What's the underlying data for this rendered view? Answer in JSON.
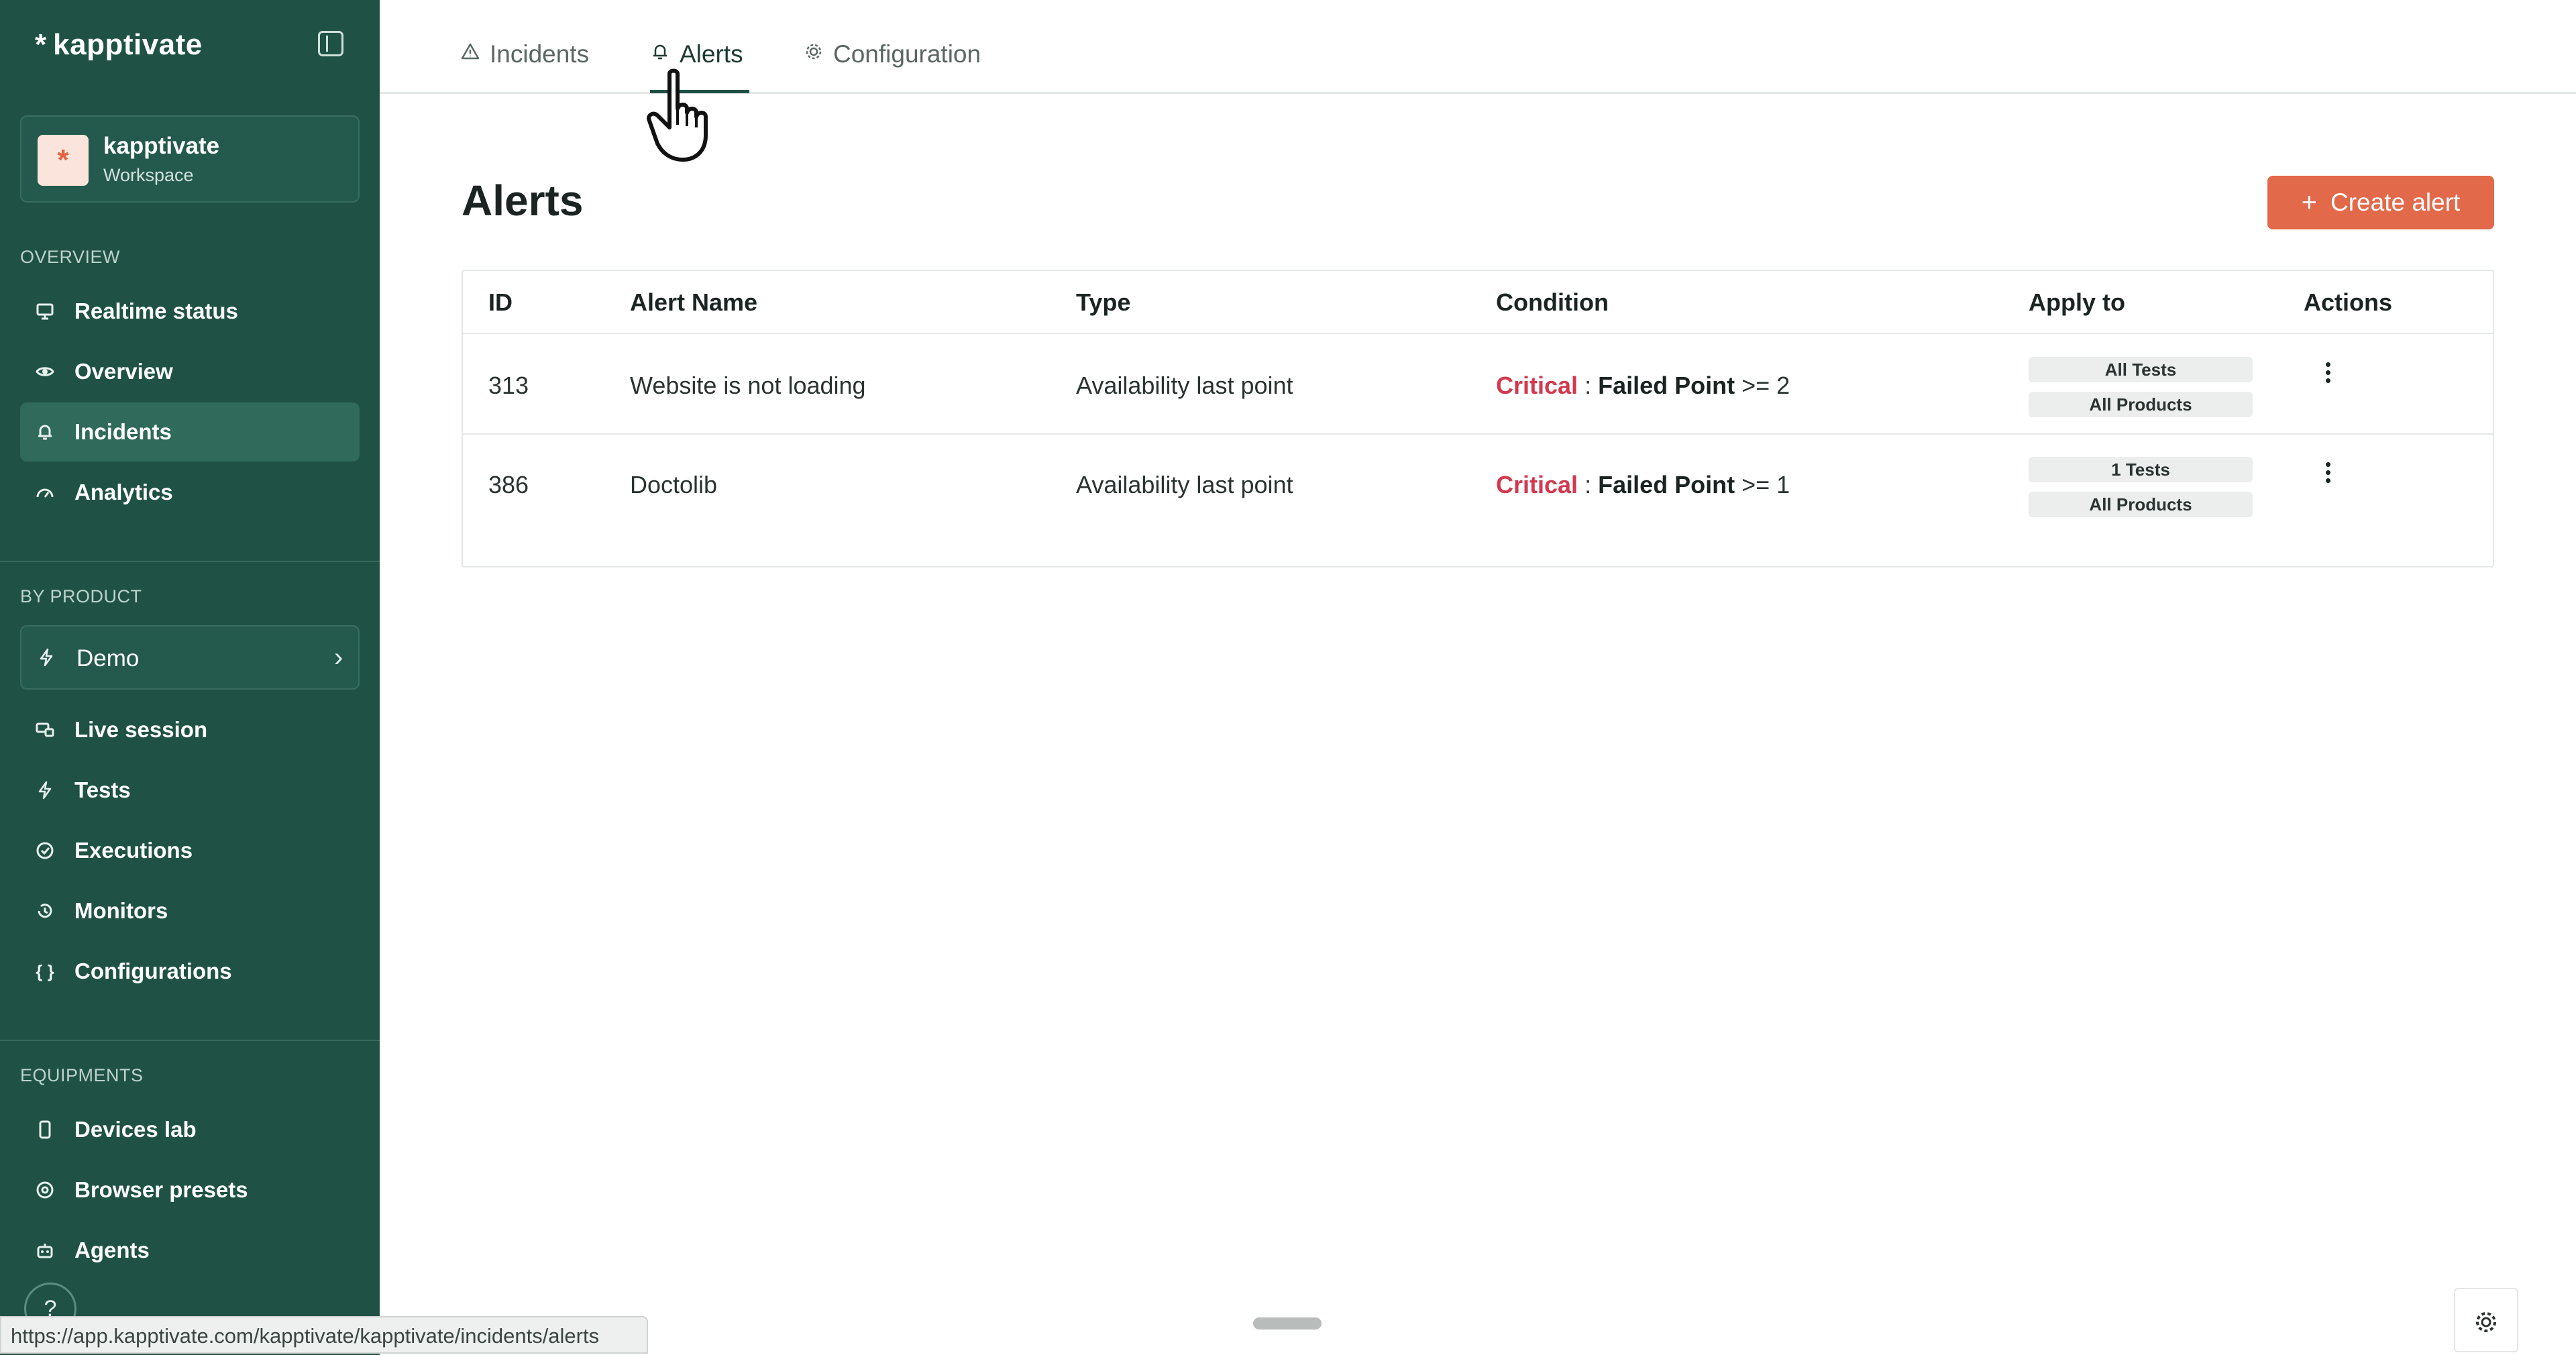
{
  "brand": {
    "name": "kapptivate",
    "mark": "*"
  },
  "workspace": {
    "name": "kapptivate",
    "subtitle": "Workspace",
    "avatar": "*"
  },
  "sidebar": {
    "overview_label": "OVERVIEW",
    "overview_items": [
      {
        "label": "Realtime status",
        "icon": "monitor-icon"
      },
      {
        "label": "Overview",
        "icon": "eye-icon"
      },
      {
        "label": "Incidents",
        "icon": "bell-icon",
        "active": true
      },
      {
        "label": "Analytics",
        "icon": "gauge-icon"
      }
    ],
    "by_product_label": "BY PRODUCT",
    "product": {
      "label": "Demo",
      "icon": "lightning-icon"
    },
    "product_items": [
      {
        "label": "Live session",
        "icon": "screens-icon"
      },
      {
        "label": "Tests",
        "icon": "lightning-icon"
      },
      {
        "label": "Executions",
        "icon": "check-circle-icon"
      },
      {
        "label": "Monitors",
        "icon": "history-icon"
      },
      {
        "label": "Configurations",
        "icon": "braces-icon"
      }
    ],
    "equipments_label": "EQUIPMENTS",
    "equipment_items": [
      {
        "label": "Devices lab",
        "icon": "phone-icon"
      },
      {
        "label": "Browser presets",
        "icon": "chrome-icon"
      },
      {
        "label": "Agents",
        "icon": "robot-icon"
      }
    ],
    "help": "?"
  },
  "tabs": [
    {
      "label": "Incidents",
      "icon": "warning-icon"
    },
    {
      "label": "Alerts",
      "icon": "bell-icon",
      "active": true
    },
    {
      "label": "Configuration",
      "icon": "gear-icon"
    }
  ],
  "page": {
    "title": "Alerts",
    "create_label": "Create alert",
    "create_plus": "+"
  },
  "table": {
    "headers": [
      "ID",
      "Alert Name",
      "Type",
      "Condition",
      "Apply to",
      "Actions"
    ],
    "rows": [
      {
        "id": "313",
        "name": "Website is not loading",
        "type": "Availability last point",
        "severity": "Critical",
        "sep": ":",
        "metric": "Failed Point",
        "op": ">= 2",
        "apply_tests": "All Tests",
        "apply_products": "All Products"
      },
      {
        "id": "386",
        "name": "Doctolib",
        "type": "Availability last point",
        "severity": "Critical",
        "sep": ":",
        "metric": "Failed Point",
        "op": ">= 1",
        "apply_tests": "1 Tests",
        "apply_products": "All Products"
      }
    ]
  },
  "status_url": "https://app.kapptivate.com/kapptivate/kapptivate/incidents/alerts",
  "colors": {
    "sidebar": "#1f5245",
    "accent": "#e2694a",
    "critical": "#d2394f"
  }
}
